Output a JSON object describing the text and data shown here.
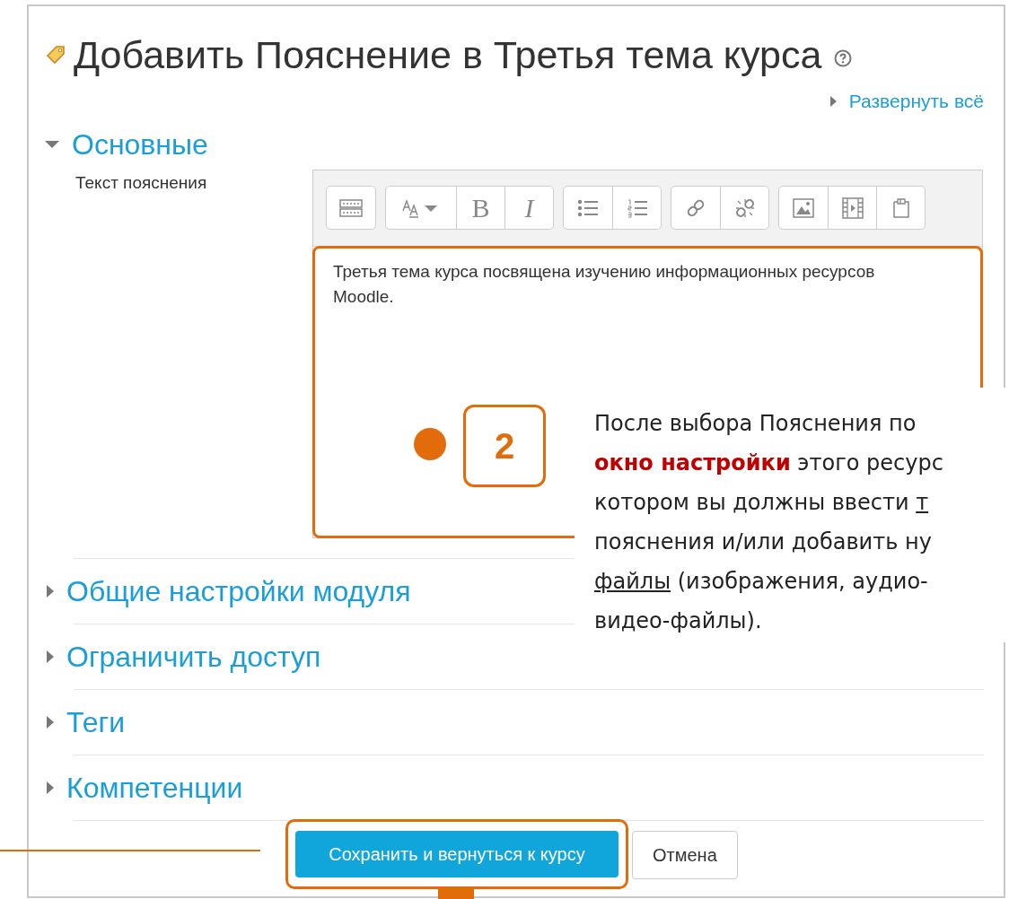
{
  "page_title": "Добавить Пояснение в Третья тема курса",
  "expand_all": "Развернуть всё",
  "sections": [
    {
      "title": "Основные",
      "expanded": true
    },
    {
      "title": "Общие настройки модуля",
      "expanded": false
    },
    {
      "title": "Ограничить доступ",
      "expanded": false
    },
    {
      "title": "Теги",
      "expanded": false
    },
    {
      "title": "Компетенции",
      "expanded": false
    }
  ],
  "field_label": "Текст пояснения",
  "editor": {
    "bold": "B",
    "italic": "I",
    "text": "Третья тема курса посвящена изучению информационных ресурсов Moodle."
  },
  "buttons": {
    "save": "Сохранить и вернуться к курсу",
    "cancel": "Отмена"
  },
  "annotation": {
    "number": "2",
    "callout_lines": [
      [
        {
          "text": "После выбора Пояснения по",
          "kind": "plain"
        }
      ],
      [
        {
          "text": "окно настройки",
          "kind": "emphasis"
        },
        {
          "text": " этого ресурс",
          "kind": "plain"
        }
      ],
      [
        {
          "text": "котором  вы должны ввести ",
          "kind": "plain"
        },
        {
          "text": "т",
          "kind": "underline"
        }
      ],
      [
        {
          "text": "пояснения и/или добавить ну",
          "kind": "plain"
        }
      ],
      [
        {
          "text": "файлы",
          "kind": "underline"
        },
        {
          "text": " (изображения, аудио-",
          "kind": "plain"
        }
      ],
      [
        {
          "text": "видео-файлы).",
          "kind": "plain"
        }
      ]
    ]
  }
}
